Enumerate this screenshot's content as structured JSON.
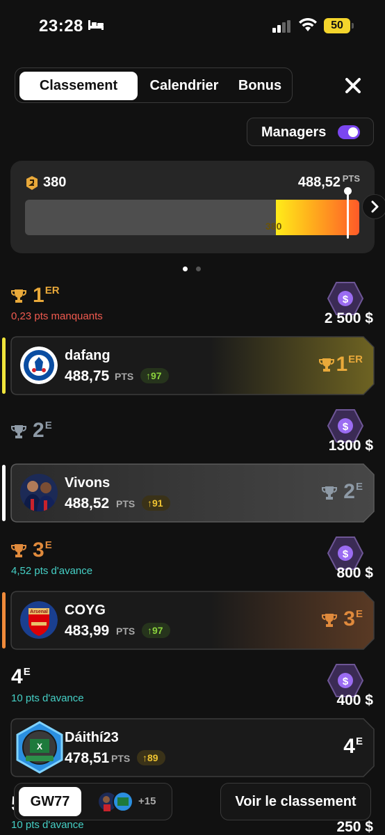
{
  "status_bar": {
    "time": "23:28",
    "battery": "50"
  },
  "tabs": [
    {
      "label": "Classement",
      "active": true
    },
    {
      "label": "Calendrier",
      "active": false
    },
    {
      "label": "Bonus",
      "active": false
    }
  ],
  "managers_toggle": {
    "label": "Managers",
    "on": true
  },
  "progress": {
    "threshold": "380",
    "my_points": "488,52",
    "points_unit": "PTS",
    "bar_label": "380",
    "fill_fraction": 0.25
  },
  "carousel": {
    "pages": 2,
    "active": 0
  },
  "tiers": [
    {
      "rank": "1",
      "suffix": "ER",
      "sub": "0,23 pts manquants",
      "sub_color": "#f05a4f",
      "prize": "2 500 $",
      "trophy": "gold"
    },
    {
      "rank": "2",
      "suffix": "E",
      "sub": "",
      "sub_color": "",
      "prize": "1300 $",
      "trophy": "silver"
    },
    {
      "rank": "3",
      "suffix": "E",
      "sub": "4,52 pts d'avance",
      "sub_color": "#45d0c6",
      "prize": "800 $",
      "trophy": "bronze"
    },
    {
      "rank": "4",
      "suffix": "E",
      "sub": "10 pts d'avance",
      "sub_color": "#45d0c6",
      "prize": "400 $",
      "trophy": "none"
    },
    {
      "rank": "5",
      "suffix": "E",
      "sub": "10 pts d'avance",
      "sub_color": "#45d0c6",
      "prize": "250 $",
      "trophy": "none"
    }
  ],
  "managers": [
    {
      "name": "dafang",
      "points": "488,75",
      "unit": "PTS",
      "delta": "97",
      "delta_style": "green",
      "rank": "1",
      "suffix": "ER",
      "accent": "#f0e53b"
    },
    {
      "name": "Vivons",
      "points": "488,52",
      "unit": "PTS",
      "delta": "91",
      "delta_style": "gold",
      "rank": "2",
      "suffix": "E",
      "accent": "#ffffff"
    },
    {
      "name": "COYG",
      "points": "483,99",
      "unit": "PTS",
      "delta": "97",
      "delta_style": "green",
      "rank": "3",
      "suffix": "E",
      "accent": "#f08a3a"
    },
    {
      "name": "Dáithí23",
      "points": "478,51",
      "unit": "PTS",
      "delta": "89",
      "delta_style": "gold",
      "rank": "4",
      "suffix": "E",
      "accent": ""
    }
  ],
  "bottom": {
    "gameweek": "GW77",
    "more": "+15",
    "view_button": "Voir le classement"
  },
  "colors": {
    "gold": "#e9a93a",
    "silver": "#8e9aa6",
    "bronze": "#e08a3c",
    "purple": "#7b46f0"
  }
}
